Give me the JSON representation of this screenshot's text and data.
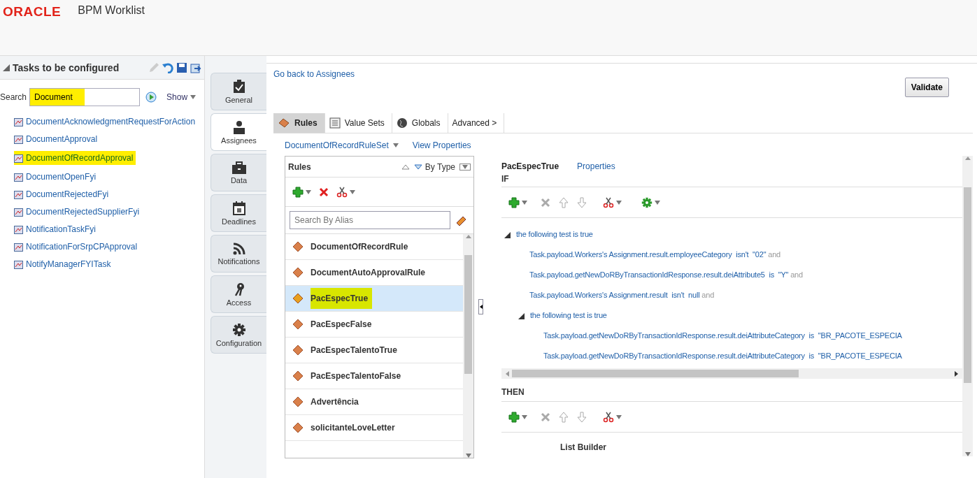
{
  "header": {
    "logo": "ORACLE",
    "title": "BPM Worklist"
  },
  "tasks_panel": {
    "title": "Tasks to be configured",
    "search_label": "Search",
    "search_value": "Document",
    "search_highlighted": true,
    "show_label": "Show",
    "items": [
      {
        "label": "DocumentAcknowledgmentRequestForAction",
        "selected": false
      },
      {
        "label": "DocumentApproval",
        "selected": false
      },
      {
        "label": "DocumentOfRecordApproval",
        "selected": true
      },
      {
        "label": "DocumentOpenFyi",
        "selected": false
      },
      {
        "label": "DocumentRejectedFyi",
        "selected": false
      },
      {
        "label": "DocumentRejectedSupplierFyi",
        "selected": false
      },
      {
        "label": "NotificationTaskFyi",
        "selected": false
      },
      {
        "label": "NotificationForSrpCPApproval",
        "selected": false
      },
      {
        "label": "NotifyManagerFYITask",
        "selected": false
      }
    ]
  },
  "side_tabs": [
    {
      "label": "General",
      "selected": false
    },
    {
      "label": "Assignees",
      "selected": true
    },
    {
      "label": "Data",
      "selected": false
    },
    {
      "label": "Deadlines",
      "selected": false
    },
    {
      "label": "Notifications",
      "selected": false
    },
    {
      "label": "Access",
      "selected": false
    },
    {
      "label": "Configuration",
      "selected": false
    }
  ],
  "back_link": "Go back to Assignees",
  "validate_button": "Validate",
  "tabs": [
    {
      "label": "Rules",
      "selected": true
    },
    {
      "label": "Value Sets",
      "selected": false
    },
    {
      "label": "Globals",
      "selected": false
    },
    {
      "label": "Advanced >",
      "selected": false
    }
  ],
  "ruleset": {
    "name": "DocumentOfRecordRuleSet",
    "view_properties": "View Properties"
  },
  "rules_panel": {
    "title": "Rules",
    "sort_label": "By Type",
    "search_placeholder": "Search By Alias",
    "rules": [
      {
        "name": "DocumentOfRecordRule",
        "selected": false
      },
      {
        "name": "DocumentAutoApprovalRule",
        "selected": false
      },
      {
        "name": "PacEspecTrue",
        "selected": true
      },
      {
        "name": "PacEspecFalse",
        "selected": false
      },
      {
        "name": "PacEspecTalentoTrue",
        "selected": false
      },
      {
        "name": "PacEspecTalentoFalse",
        "selected": false
      },
      {
        "name": "Advertência",
        "selected": false
      },
      {
        "name": "solicitanteLoveLetter",
        "selected": false
      }
    ]
  },
  "rule_detail": {
    "name": "PacEspecTrue",
    "properties": "Properties",
    "if_label": "IF",
    "then_label": "THEN",
    "if_tree": {
      "label": "the following test is true",
      "expanded": true,
      "children": [
        {
          "kind": "condition",
          "text": "Task.payload.Workers's Assignment.result.employeeCategory  isn't  \"02\"",
          "conj": "and"
        },
        {
          "kind": "condition",
          "text": "Task.payload.getNewDoRByTransactionIdResponse.result.deiAttribute5  is  \"Y\"",
          "conj": "and"
        },
        {
          "kind": "condition",
          "text": "Task.payload.Workers's Assignment.result  isn't  null",
          "conj": "and"
        },
        {
          "kind": "group",
          "label": "the following test is true",
          "expanded": true,
          "children": [
            {
              "kind": "condition",
              "text": "Task.payload.getNewDoRByTransactionIdResponse.result.deiAttributeCategory  is  \"BR_PACOTE_ESPECIA"
            },
            {
              "kind": "condition",
              "text": "Task.payload.getNewDoRByTransactionIdResponse.result.deiAttributeCategory  is  \"BR_PACOTE_ESPECIA"
            }
          ]
        }
      ]
    },
    "then_action": "List Builder"
  }
}
